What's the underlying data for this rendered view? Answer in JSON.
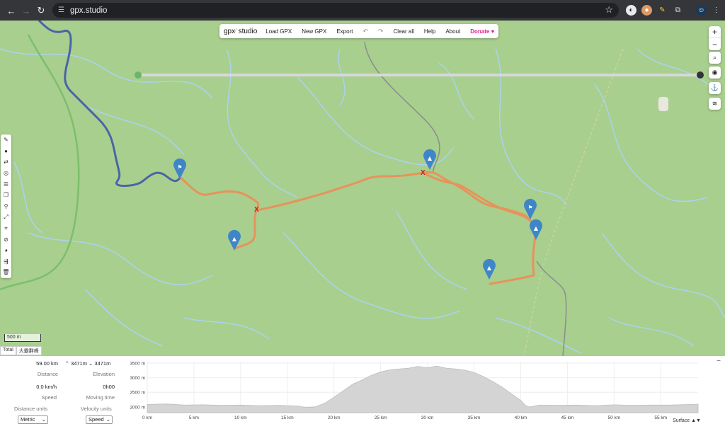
{
  "browser": {
    "url": "gpx.studio",
    "nav_icons": [
      "back-icon",
      "forward-icon",
      "reload-icon"
    ]
  },
  "menu": {
    "logo": "gpx",
    "logo_suffix": "studio",
    "items": [
      "Load GPX",
      "New GPX",
      "Export"
    ],
    "clear": "Clear all",
    "help": "Help",
    "about": "About",
    "donate": "Donate",
    "donate_heart": "♥"
  },
  "zoom": {
    "in": "+",
    "out": "−"
  },
  "scale_label": "500 m",
  "tabs": [
    "Total",
    "大霸群峰"
  ],
  "stats": {
    "distance_value": "59.00 km",
    "distance_label": "Distance",
    "elev_value": "⌃ 3471m  ⌄ 3471m",
    "elev_label": "Elevation",
    "speed_value": "0.0 km/h",
    "speed_label": "Speed",
    "moving_value": "0h00",
    "moving_label": "Moving time",
    "dist_units_label": "Distance units",
    "vel_units_label": "Velocity units",
    "dist_units_value": "Metric",
    "vel_units_value": "Speed"
  },
  "surface_label": "Surface ▲▼",
  "colors": {
    "track": "#e8925a",
    "route": "#4a64a8",
    "map": "#a8cf8e",
    "water": "#aad3f0",
    "marker": "#3f86c8"
  },
  "chart_data": {
    "type": "area",
    "x_ticks": [
      "0 km",
      "5 km",
      "10 km",
      "15 km",
      "20 km",
      "25 km",
      "30 km",
      "35 km",
      "40 km",
      "45 km",
      "50 km",
      "55 km"
    ],
    "y_ticks": [
      "2000 m",
      "2500 m",
      "3000 m",
      "3500 m"
    ],
    "ylim": [
      1800,
      3550
    ],
    "xlim": [
      0,
      59
    ],
    "x": [
      0,
      2,
      4,
      6,
      8,
      10,
      12,
      14,
      16,
      17,
      18,
      19,
      20,
      21,
      22,
      23,
      24,
      25,
      26,
      27,
      28,
      29,
      30,
      31,
      32,
      33,
      34,
      35,
      36,
      37,
      38,
      39,
      40,
      40.5,
      41,
      42,
      44,
      46,
      48,
      50,
      52,
      54,
      56,
      58,
      59
    ],
    "y": [
      2080,
      2100,
      2060,
      2070,
      2050,
      2060,
      2040,
      2050,
      2030,
      1980,
      2000,
      2120,
      2330,
      2550,
      2780,
      2920,
      3080,
      3200,
      3270,
      3300,
      3330,
      3390,
      3340,
      3400,
      3330,
      3300,
      3260,
      3180,
      3040,
      2870,
      2680,
      2450,
      2220,
      2050,
      1990,
      2060,
      2050,
      2060,
      2040,
      2070,
      2050,
      2060,
      2060,
      2080,
      2090
    ]
  }
}
